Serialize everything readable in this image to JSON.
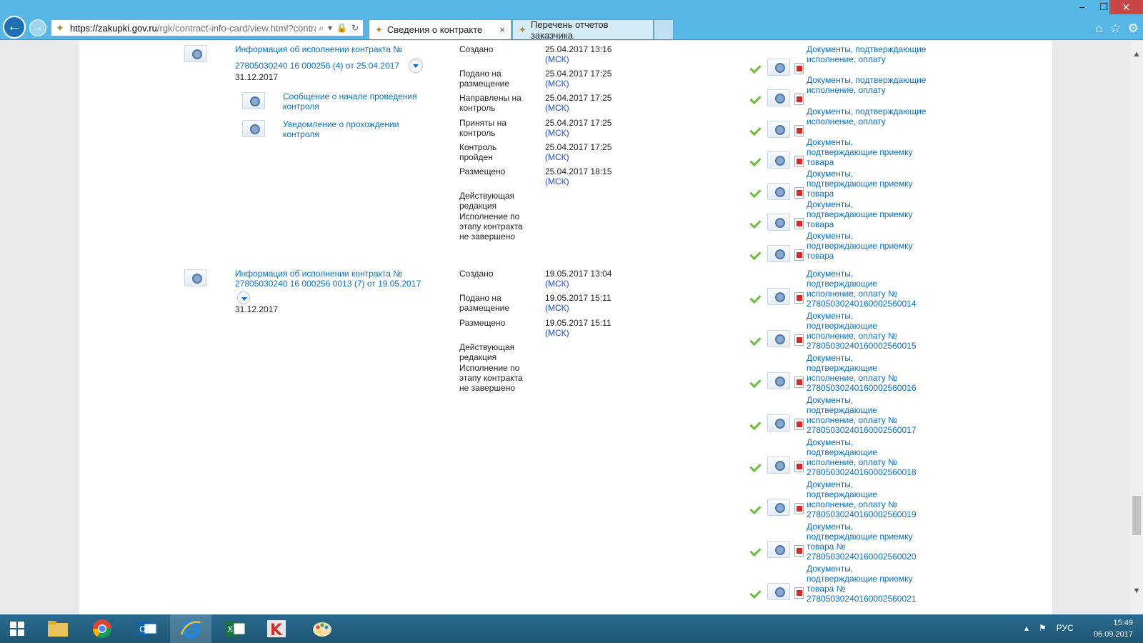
{
  "browser": {
    "url_host": "https://zakupki.gov.ru",
    "url_path": "/rgk/contract-info-card/view.html?contrac",
    "tabs": [
      {
        "label": "Сведения о контракте",
        "active": true
      },
      {
        "label": "Перечень отчетов заказчика",
        "active": false
      }
    ],
    "close_tab_glyph": "×",
    "win_min": "–",
    "win_max": "❐",
    "win_close": "✕",
    "icon_names": [
      "home-icon",
      "favorites-star-icon",
      "settings-gear-icon",
      "search-icon",
      "lock-icon",
      "refresh-icon"
    ]
  },
  "records": [
    {
      "title_line1": "Информация об исполнении контракта №",
      "title_line2": "27805030240 16 000256 (4) от 25.04.2017",
      "date": "31.12.2017",
      "sub_items": [
        "Сообщение о начале проведения контроля",
        "Уведомление о прохождении контроля"
      ],
      "statuses": [
        {
          "label": "Создано",
          "time": "25.04.2017 13:16",
          "tz": "(МСК)"
        },
        {
          "label": "Подано на размещение",
          "time": "25.04.2017 17:25",
          "tz": "(МСК)"
        },
        {
          "label": "Направлены на контроль",
          "time": "25.04.2017 17:25",
          "tz": "(МСК)"
        },
        {
          "label": "Приняты на контроль",
          "time": "25.04.2017 17:25",
          "tz": "(МСК)"
        },
        {
          "label": "Контроль пройден",
          "time": "25.04.2017 17:25",
          "tz": "(МСК)"
        },
        {
          "label": "Размещено",
          "time": "25.04.2017 18:15",
          "tz": "(МСК)"
        }
      ],
      "footer_line1": "Действующая редакция",
      "footer_line2": "Исполнение по этапу контракта не завершено",
      "documents": [
        "Документы, подтверждающие исполнение, оплату",
        "Документы, подтверждающие исполнение, оплату",
        "Документы, подтверждающие исполнение, оплату",
        "Документы, подтверждающие приемку товара",
        "Документы, подтверждающие приемку товара",
        "Документы, подтверждающие приемку товара",
        "Документы, подтверждающие приемку товара"
      ]
    },
    {
      "title_line1": "Информация об исполнении контракта №",
      "title_line2": "27805030240 16 000256 0013 (7) от 19.05.2017",
      "date": "31.12.2017",
      "statuses": [
        {
          "label": "Создано",
          "time": "19.05.2017 13:04",
          "tz": "(МСК)"
        },
        {
          "label": "Подано на размещение",
          "time": "19.05.2017 15:11",
          "tz": "(МСК)"
        },
        {
          "label": "Размещено",
          "time": "19.05.2017 15:11",
          "tz": "(МСК)"
        }
      ],
      "footer_line1": "Действующая редакция",
      "footer_line2": "Исполнение по этапу контракта не завершено",
      "documents": [
        "Документы, подтверждающие исполнение, оплату № 27805030240160002560014",
        "Документы, подтверждающие исполнение, оплату № 27805030240160002560015",
        "Документы, подтверждающие исполнение, оплату № 27805030240160002560016",
        "Документы, подтверждающие исполнение, оплату № 27805030240160002560017",
        "Документы, подтверждающие исполнение, оплату № 27805030240160002560018",
        "Документы, подтверждающие исполнение, оплату № 27805030240160002560019",
        "Документы, подтверждающие приемку товара № 27805030240160002560020",
        "Документы, подтверждающие приемку товара № 27805030240160002560021"
      ]
    }
  ],
  "taskbar": {
    "lang": "РУС",
    "time": "15:49",
    "date": "06.09.2017"
  }
}
